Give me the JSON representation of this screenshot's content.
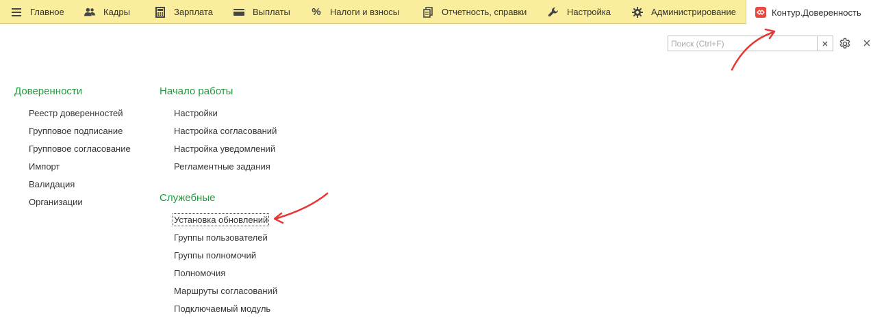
{
  "nav": {
    "items": [
      {
        "label": "Главное",
        "icon": "menu-icon"
      },
      {
        "label": "Кадры",
        "icon": "users-icon"
      },
      {
        "label": "Зарплата",
        "icon": "calculator-icon"
      },
      {
        "label": "Выплаты",
        "icon": "card-icon"
      },
      {
        "label": "Налоги и взносы",
        "icon": "percent-icon"
      },
      {
        "label": "Отчетность, справки",
        "icon": "documents-icon"
      },
      {
        "label": "Настройка",
        "icon": "wrench-icon"
      },
      {
        "label": "Администрирование",
        "icon": "gear-icon"
      },
      {
        "label": "Контур.Доверенность",
        "icon": "kontur-logo-icon",
        "active": true
      }
    ]
  },
  "search": {
    "placeholder": "Поиск (Ctrl+F)",
    "value": ""
  },
  "sections": {
    "doverennosti": {
      "title": "Доверенности",
      "items": [
        "Реестр доверенностей",
        "Групповое подписание",
        "Групповое согласование",
        "Импорт",
        "Валидация",
        "Организации"
      ]
    },
    "nachalo": {
      "title": "Начало работы",
      "items": [
        "Настройки",
        "Настройка согласований",
        "Настройка уведомлений",
        "Регламентные задания"
      ]
    },
    "sluzhebnye": {
      "title": "Служебные",
      "items": [
        "Установка обновлений",
        "Группы пользователей",
        "Группы полномочий",
        "Полномочия",
        "Маршруты согласований",
        "Подключаемый модуль"
      ]
    }
  },
  "colors": {
    "nav_bg": "#fbed9e",
    "section_title": "#1f9c3e",
    "annotation_arrow": "#e53935",
    "kontur_logo": "#e8483f"
  }
}
